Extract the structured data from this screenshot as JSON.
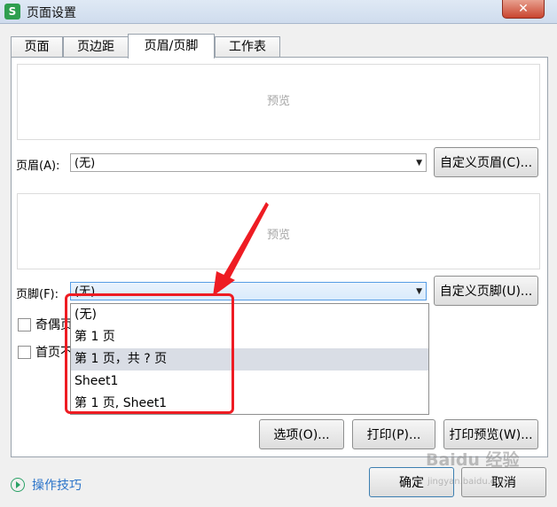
{
  "window": {
    "title": "页面设置",
    "app_icon": "S",
    "close_symbol": "✕"
  },
  "tabs": [
    {
      "label": "页面",
      "active": false
    },
    {
      "label": "页边距",
      "active": false
    },
    {
      "label": "页眉/页脚",
      "active": true
    },
    {
      "label": "工作表",
      "active": false
    }
  ],
  "header": {
    "preview_text": "预览",
    "label": "页眉(A):",
    "value": "(无)",
    "custom_button": "自定义页眉(C)..."
  },
  "footer": {
    "preview_text": "预览",
    "label": "页脚(F):",
    "value": "(无)",
    "custom_button": "自定义页脚(U)..."
  },
  "checkboxes": [
    {
      "label": "奇偶页",
      "checked": false
    },
    {
      "label": "首页不",
      "checked": false
    }
  ],
  "dropdown": {
    "options": [
      "(无)",
      "第 1 页",
      "第 1 页，共 ? 页",
      "Sheet1",
      "第 1 页, Sheet1"
    ],
    "hovered_index": 2
  },
  "buttons": {
    "options": "选项(O)...",
    "print": "打印(P)...",
    "print_preview": "打印预览(W)...",
    "ok": "确定",
    "cancel": "取消"
  },
  "tips": "操作技巧",
  "watermark": {
    "text": "Baidu 经验",
    "sub": "jingyan.baidu.com"
  },
  "colors": {
    "annotation": "#ee1c23",
    "link": "#2a73c9",
    "app_icon_bg": "#2e9e4f",
    "close_bg": "#c9452f"
  }
}
